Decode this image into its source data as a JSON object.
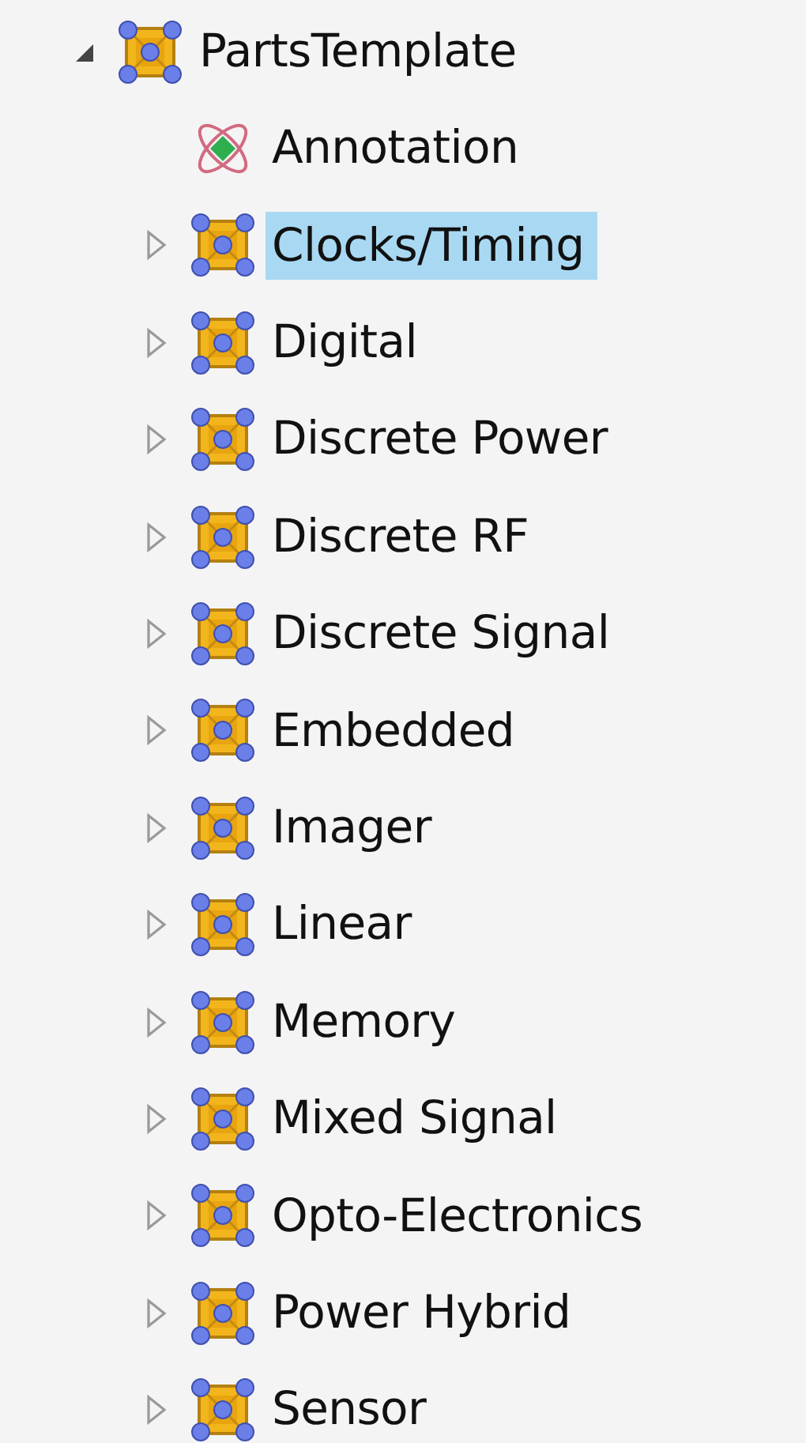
{
  "tree": [
    {
      "label": "PartsTemplate",
      "kind": "group",
      "expanded": true,
      "selected": false,
      "children": [
        {
          "label": "Annotation",
          "kind": "annotation",
          "selected": false
        },
        {
          "label": "Clocks/Timing",
          "kind": "group",
          "expanded": false,
          "selected": true
        },
        {
          "label": "Digital",
          "kind": "group",
          "expanded": false,
          "selected": false
        },
        {
          "label": "Discrete Power",
          "kind": "group",
          "expanded": false,
          "selected": false
        },
        {
          "label": "Discrete RF",
          "kind": "group",
          "expanded": false,
          "selected": false
        },
        {
          "label": "Discrete Signal",
          "kind": "group",
          "expanded": false,
          "selected": false
        },
        {
          "label": "Embedded",
          "kind": "group",
          "expanded": false,
          "selected": false
        },
        {
          "label": "Imager",
          "kind": "group",
          "expanded": false,
          "selected": false
        },
        {
          "label": "Linear",
          "kind": "group",
          "expanded": false,
          "selected": false
        },
        {
          "label": "Memory",
          "kind": "group",
          "expanded": false,
          "selected": false
        },
        {
          "label": "Mixed Signal",
          "kind": "group",
          "expanded": false,
          "selected": false
        },
        {
          "label": "Opto-Electronics",
          "kind": "group",
          "expanded": false,
          "selected": false
        },
        {
          "label": "Power Hybrid",
          "kind": "group",
          "expanded": false,
          "selected": false
        },
        {
          "label": "Sensor",
          "kind": "group",
          "expanded": false,
          "selected": false
        }
      ]
    }
  ]
}
